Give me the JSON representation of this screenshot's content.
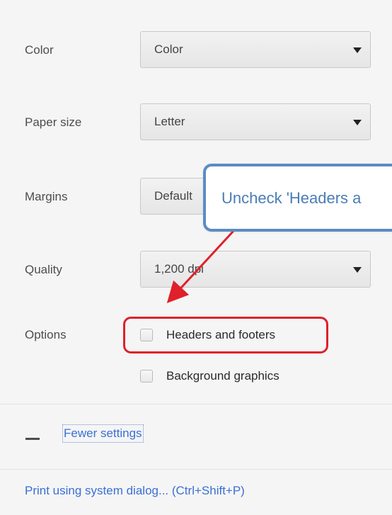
{
  "settings": {
    "color": {
      "label": "Color",
      "value": "Color"
    },
    "paper_size": {
      "label": "Paper size",
      "value": "Letter"
    },
    "margins": {
      "label": "Margins",
      "value": "Default"
    },
    "quality": {
      "label": "Quality",
      "value": "1,200 dpi"
    },
    "options": {
      "label": "Options",
      "headers_footers": {
        "label": "Headers and footers",
        "checked": false
      },
      "background_graphics": {
        "label": "Background graphics",
        "checked": false
      }
    }
  },
  "fewer_settings": {
    "label": "Fewer settings"
  },
  "system_dialog": {
    "label": "Print using system dialog... (Ctrl+Shift+P)"
  },
  "annotation": {
    "callout_text": "Uncheck 'Headers a",
    "highlight_color": "#e0202a",
    "callout_border_color": "#5b8cc4",
    "arrow_color": "#e0202a"
  }
}
